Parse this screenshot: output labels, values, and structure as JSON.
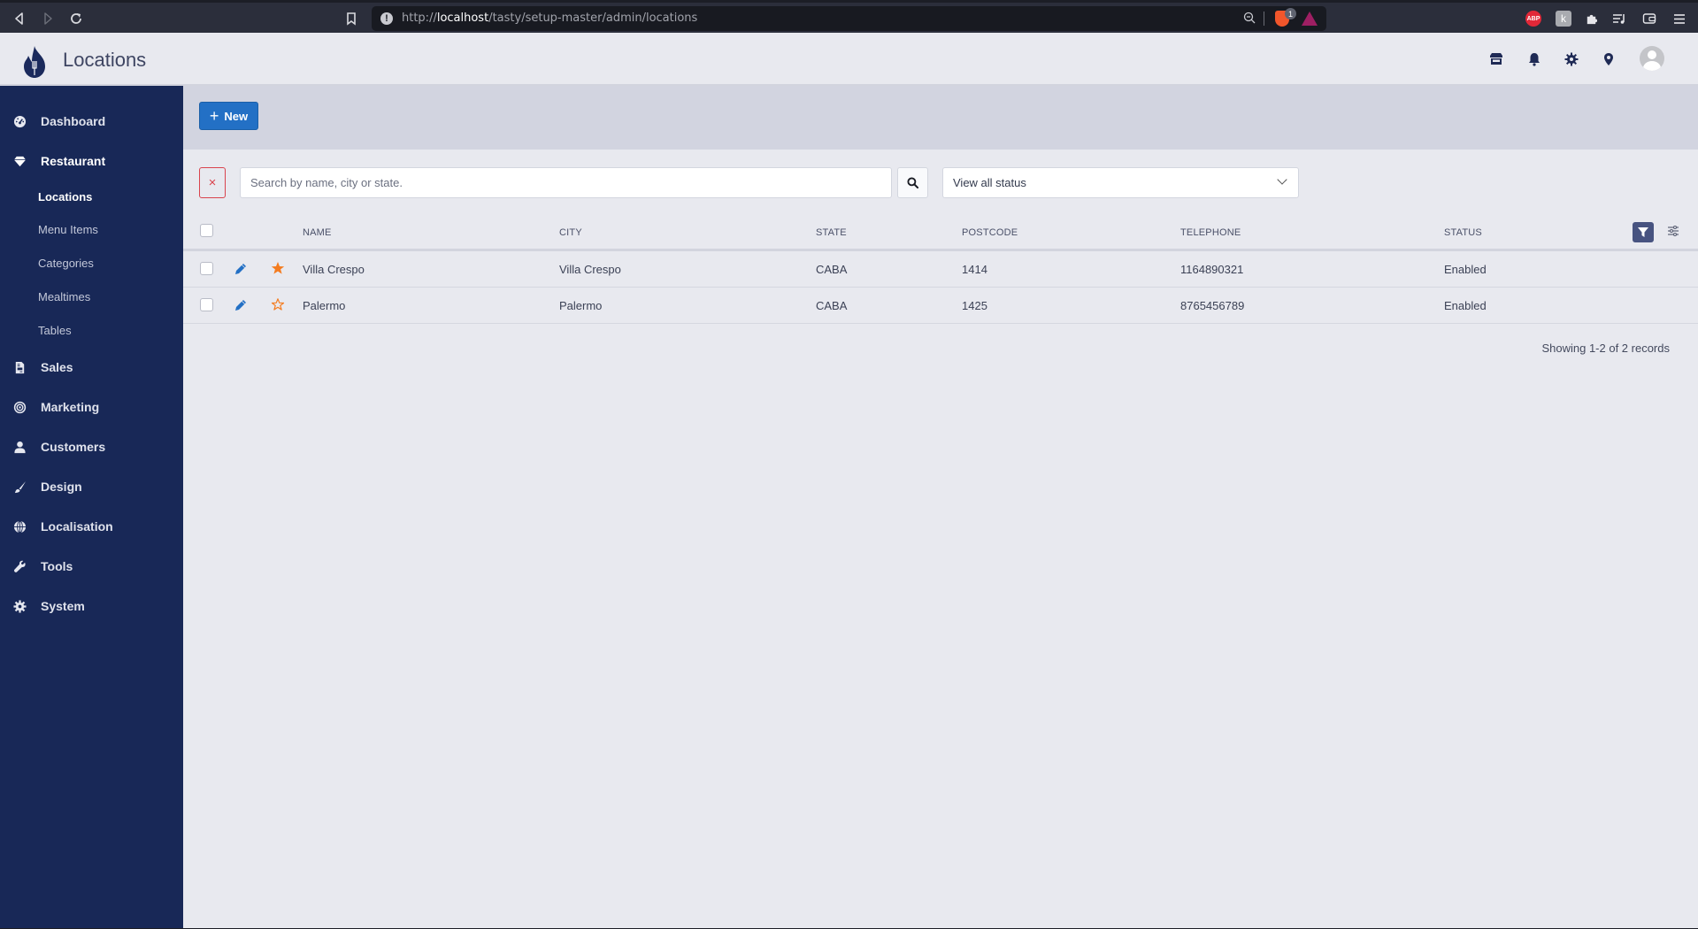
{
  "browser": {
    "url_prefix": "http://",
    "url_host": "localhost",
    "url_path": "/tasty/setup-master/admin/locations",
    "shield_badge": "1",
    "extensions": [
      {
        "name": "adblock-plus",
        "label": "ABP"
      },
      {
        "name": "k-extension",
        "label": "k"
      }
    ]
  },
  "header": {
    "title": "Locations",
    "icons": [
      "store-icon",
      "bell-icon",
      "gear-icon",
      "map-marker-icon",
      "user-avatar"
    ]
  },
  "sidebar": {
    "items": [
      {
        "label": "Dashboard",
        "icon": "tachometer-icon"
      },
      {
        "label": "Restaurant",
        "icon": "gem-icon",
        "active": true,
        "children": [
          {
            "label": "Locations",
            "active": true
          },
          {
            "label": "Menu Items"
          },
          {
            "label": "Categories"
          },
          {
            "label": "Mealtimes"
          },
          {
            "label": "Tables"
          }
        ]
      },
      {
        "label": "Sales",
        "icon": "file-invoice-icon"
      },
      {
        "label": "Marketing",
        "icon": "bullseye-icon"
      },
      {
        "label": "Customers",
        "icon": "user-icon"
      },
      {
        "label": "Design",
        "icon": "paint-brush-icon"
      },
      {
        "label": "Localisation",
        "icon": "globe-icon"
      },
      {
        "label": "Tools",
        "icon": "wrench-icon"
      },
      {
        "label": "System",
        "icon": "cog-icon"
      }
    ]
  },
  "toolbar": {
    "new_label": "New"
  },
  "filters": {
    "clear_label": "×",
    "search_placeholder": "Search by name, city or state.",
    "search_value": "",
    "status_selected": "View all status"
  },
  "table": {
    "columns": [
      "Name",
      "City",
      "State",
      "Postcode",
      "Telephone",
      "Status"
    ],
    "rows": [
      {
        "name": "Villa Crespo",
        "city": "Villa Crespo",
        "state": "CABA",
        "postcode": "1414",
        "telephone": "1164890321",
        "status": "Enabled",
        "default": true
      },
      {
        "name": "Palermo",
        "city": "Palermo",
        "state": "CABA",
        "postcode": "1425",
        "telephone": "8765456789",
        "status": "Enabled",
        "default": false
      }
    ],
    "records_text": "Showing 1-2 of 2 records"
  },
  "colors": {
    "sidebar_bg": "#182857",
    "primary": "#2370c5",
    "star": "#f47c20",
    "danger": "#d9434d",
    "filter_btn": "#475380"
  }
}
